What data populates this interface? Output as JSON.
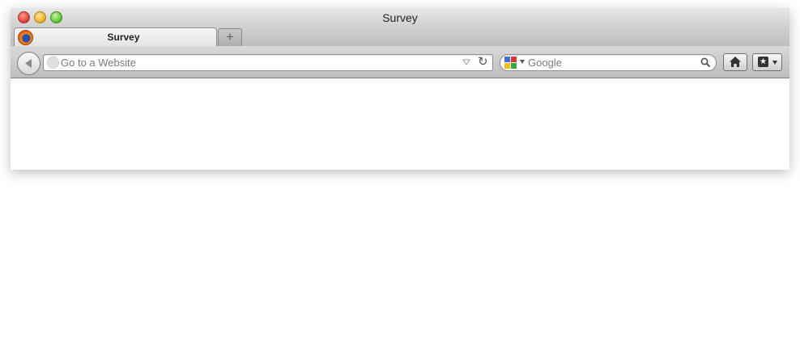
{
  "window": {
    "title": "Survey",
    "controls": [
      "close",
      "minimize",
      "zoom"
    ]
  },
  "tabs": [
    {
      "label": "Survey",
      "icon": "firefox-icon",
      "active": true
    }
  ],
  "new_tab_label": "+",
  "navigation": {
    "back_icon": "back-arrow-icon",
    "url_placeholder": "Go to a Website",
    "url_value": "",
    "reload_glyph": "↻"
  },
  "search": {
    "engine": "Google",
    "placeholder": "Google",
    "value": ""
  },
  "toolbar_buttons": {
    "home_icon": "home-icon",
    "bookmarks_icon": "bookmark-star-icon",
    "bookmarks_glyph": "★"
  }
}
